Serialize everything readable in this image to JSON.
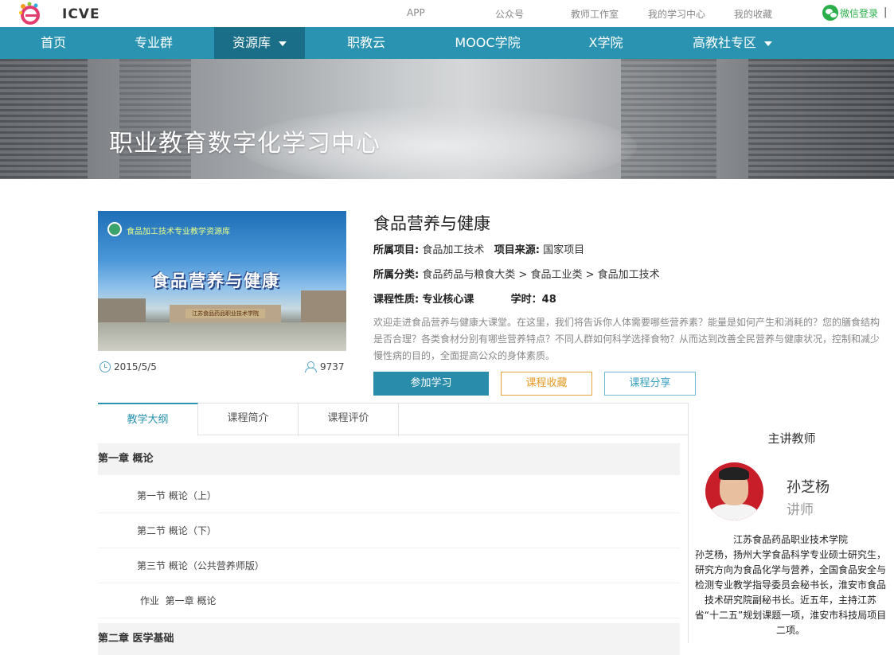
{
  "top": {
    "logo_text": "ICVE",
    "links": [
      "APP",
      "公众号",
      "教师工作室",
      "我的学习中心",
      "我的收藏"
    ],
    "wechat_login": "微信登录",
    "separator": "|"
  },
  "nav": {
    "items": [
      "首页",
      "专业群",
      "资源库",
      "职教云",
      "MOOC学院",
      "X学院",
      "高教社专区"
    ],
    "active_index": 2
  },
  "banner": {
    "title": "职业教育数字化学习中心"
  },
  "cover": {
    "subtitle": "食品加工技术专业教学资源库",
    "title": "食品营养与健康",
    "gate_text": "江苏食品药品职业技术学院"
  },
  "course": {
    "date": "2015/5/5",
    "learners": "9737",
    "title": "食品营养与健康",
    "project_label": "所属项目:",
    "project_value": "食品加工技术",
    "source_label": "项目来源:",
    "source_value": "国家项目",
    "category_label": "所属分类:",
    "category_value": "食品药品与粮食大类 > 食品工业类 > 食品加工技术",
    "nature_label": "课程性质:",
    "nature_value": "专业核心课",
    "hours_label": "学时：",
    "hours_value": "48",
    "description": "欢迎走进食品营养与健康大课堂。在这里，我们将告诉你人体需要哪些营养素？能量是如何产生和消耗的？您的膳食结构是否合理？各类食材分别有哪些营养特点？不同人群如何科学选择食物？从而达到改善全民营养与健康状况，控制和减少慢性病的目的，全面提高公众的身体素质。"
  },
  "buttons": {
    "join": "参加学习",
    "favorite": "课程收藏",
    "share": "课程分享"
  },
  "tabs": [
    "教学大纲",
    "课程简介",
    "课程评价"
  ],
  "outline": {
    "chapter1": "第一章 概论",
    "sections": [
      "第一节 概论（上）",
      "第二节 概论（下）",
      "第三节 概论（公共营养师版）",
      "作业  第一章 概论"
    ],
    "chapter2": "第二章 医学基础"
  },
  "teacher": {
    "heading": "主讲教师",
    "name": "孙芝杨",
    "title": "讲师",
    "school": "江苏食品药品职业技术学院",
    "bio": "孙芝杨，扬州大学食品科学专业硕士研究生，研究方向为食品化学与营养，全国食品安全与检测专业教学指导委员会秘书长，淮安市食品技术研究院副秘书长。近五年，主持江苏省“十二五”规划课题一项，淮安市科技局项目二项。"
  },
  "colors": {
    "nav": "#2a93b1",
    "nav_active": "#1a6e87",
    "accent_orange": "#e59a24",
    "wechat_green": "#2aae4a"
  }
}
